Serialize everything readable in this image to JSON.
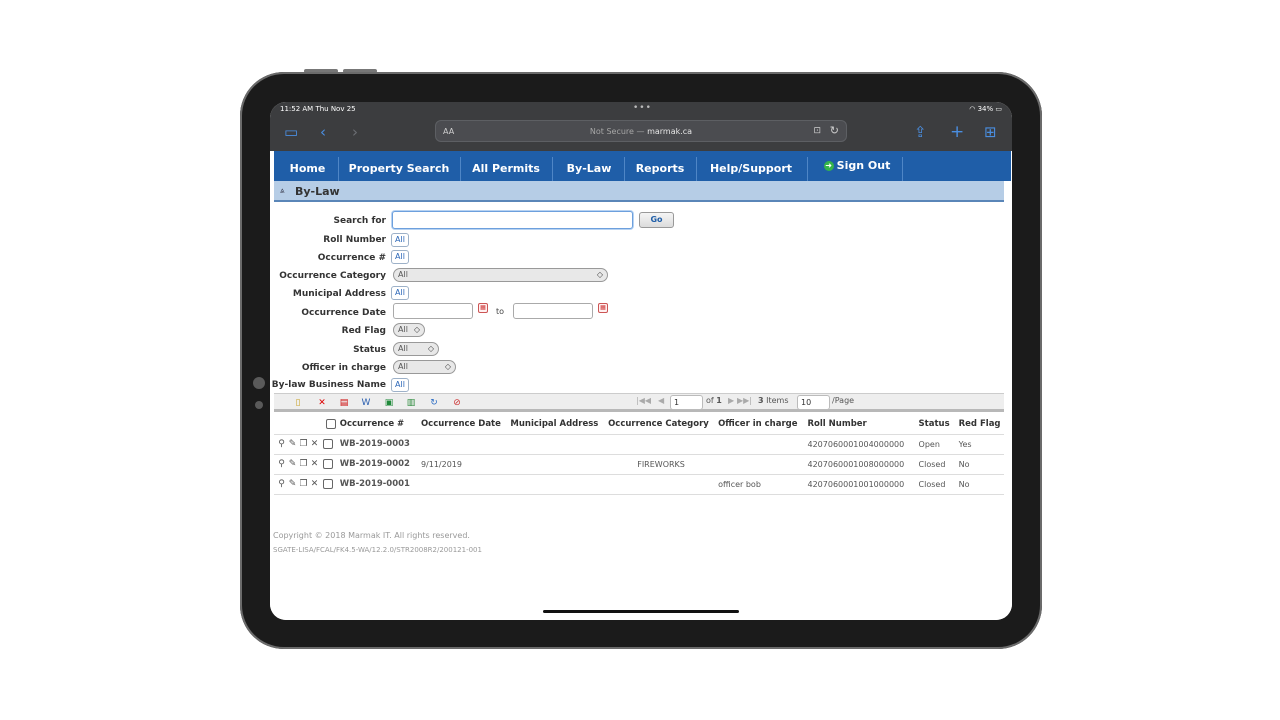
{
  "status_bar": {
    "time": "11:52 AM  Thu Nov 25",
    "battery": "34%"
  },
  "browser": {
    "text_size_label": "AA",
    "security": "Not Secure — ",
    "domain": "marmak.ca"
  },
  "nav": {
    "items": [
      "Home",
      "Property Search",
      "All Permits",
      "By-Law",
      "Reports",
      "Help/Support"
    ],
    "sign_out": "Sign Out"
  },
  "section": {
    "title": "By-Law"
  },
  "form": {
    "search_label": "Search for",
    "go_label": "Go",
    "roll_number_label": "Roll Number",
    "roll_number_value": "All",
    "occurrence_label": "Occurrence #",
    "occurrence_value": "All",
    "category_label": "Occurrence Category",
    "category_value": "All",
    "address_label": "Municipal Address",
    "address_value": "All",
    "date_label": "Occurrence Date",
    "date_to": "to",
    "red_flag_label": "Red Flag",
    "red_flag_value": "All",
    "status_label": "Status",
    "status_value": "All",
    "officer_label": "Officer in charge",
    "officer_value": "All",
    "business_label": "By-law Business Name",
    "business_value": "All"
  },
  "pager": {
    "page": "1",
    "of_label": "of",
    "total_pages": "1",
    "items_count": "3",
    "items_label": "Items",
    "page_size": "10",
    "per_page_label": "/Page"
  },
  "grid": {
    "columns": [
      "Occurrence #",
      "Occurrence Date",
      "Municipal Address",
      "Occurrence Category",
      "Officer in charge",
      "Roll Number",
      "Status",
      "Red Flag"
    ],
    "rows": [
      {
        "occ": "WB-2019-0003",
        "date": "",
        "address": "",
        "category": "",
        "officer": "",
        "roll": "4207060001004000000",
        "status": "Open",
        "flag": "Yes"
      },
      {
        "occ": "WB-2019-0002",
        "date": "9/11/2019",
        "address": "",
        "category": "FIREWORKS",
        "officer": "",
        "roll": "4207060001008000000",
        "status": "Closed",
        "flag": "No"
      },
      {
        "occ": "WB-2019-0001",
        "date": "",
        "address": "",
        "category": "",
        "officer": "officer bob",
        "roll": "4207060001001000000",
        "status": "Closed",
        "flag": "No"
      }
    ]
  },
  "footer": {
    "copyright": "Copyright © 2018 Marmak IT. All rights reserved.",
    "version": "SGATE-LISA/FCAL/FK4.5-WA/12.2.0/STR2008R2/200121-001"
  }
}
